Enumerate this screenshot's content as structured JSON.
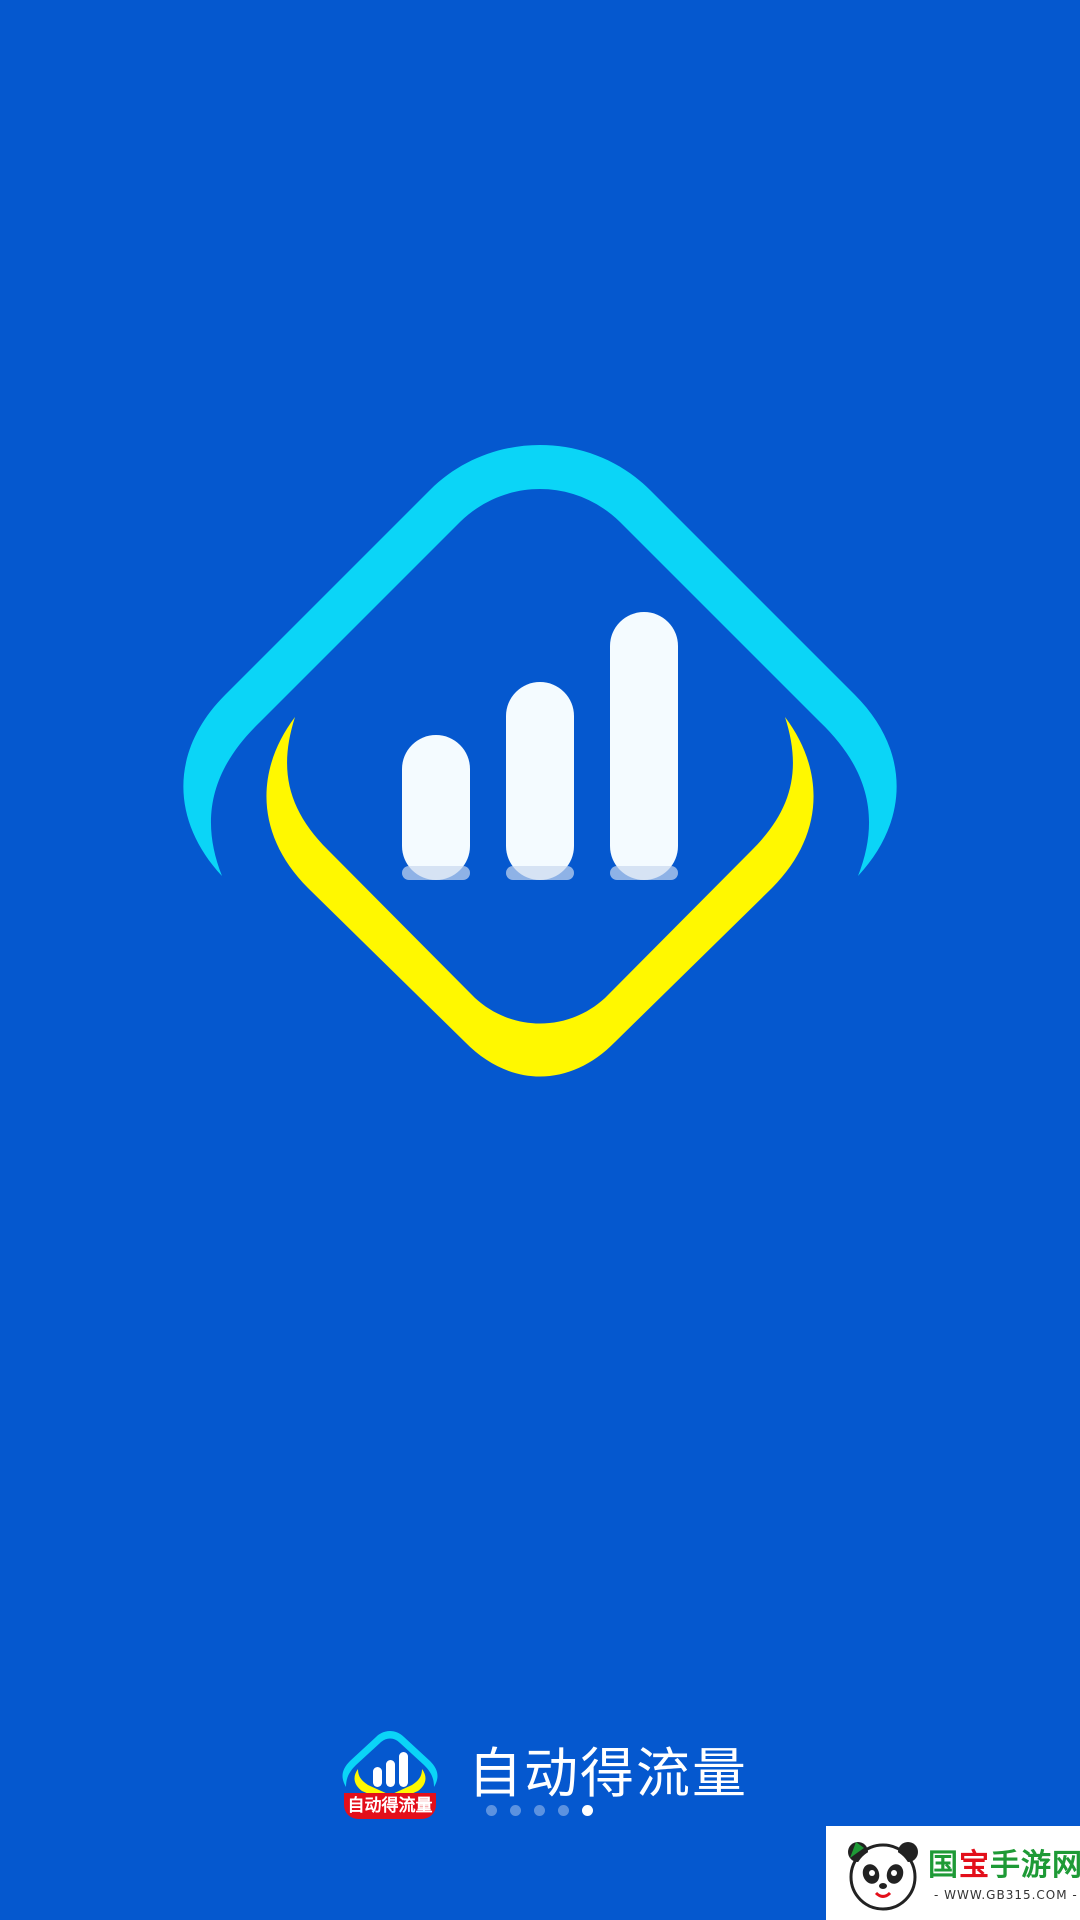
{
  "colors": {
    "background": "#0558CF",
    "logo_outer": "#0BD5F7",
    "logo_inner": "#FFF800",
    "bars": "#F4FBFF",
    "badge_red": "#E30F1A",
    "watermark_green": "#1E9A36"
  },
  "splash": {
    "logo_icon": "signal-bars-icon"
  },
  "footer": {
    "app_icon": "app-logo-icon",
    "app_icon_label": "自动得流量",
    "app_name": "自动得流量",
    "page_count": 5,
    "active_page": 5
  },
  "watermark": {
    "title_part1": "国",
    "title_part2": "宝",
    "title_part3": "手游网",
    "url": "- WWW.GB315.COM -",
    "icon": "panda-icon"
  }
}
